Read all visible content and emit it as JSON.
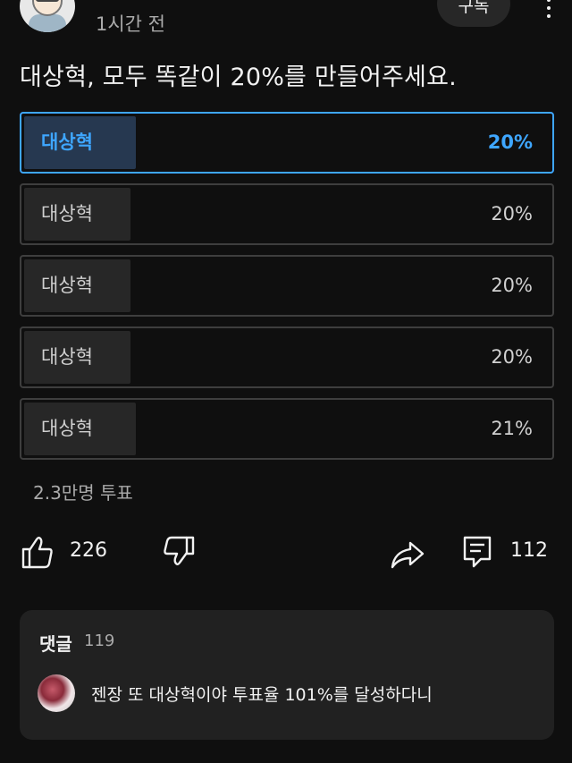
{
  "header": {
    "time_ago": "1시간 전",
    "subscribe_label": "구독"
  },
  "poll": {
    "question": "대상혁, 모두 똑같이 20%를 만들어주세요.",
    "options": [
      {
        "label": "대상혁",
        "percent_text": "20%",
        "fill_fraction": 0.21,
        "selected": true
      },
      {
        "label": "대상혁",
        "percent_text": "20%",
        "fill_fraction": 0.2,
        "selected": false
      },
      {
        "label": "대상혁",
        "percent_text": "20%",
        "fill_fraction": 0.2,
        "selected": false
      },
      {
        "label": "대상혁",
        "percent_text": "20%",
        "fill_fraction": 0.2,
        "selected": false
      },
      {
        "label": "대상혁",
        "percent_text": "21%",
        "fill_fraction": 0.21,
        "selected": false
      }
    ],
    "votes": "2.3만명 투표"
  },
  "actions": {
    "like_count": "226",
    "comment_count": "112"
  },
  "comments": {
    "title": "댓글",
    "count": "119",
    "top_comment": "젠장 또 대상혁이야 투표율 101%를 달성하다니"
  },
  "colors": {
    "accent": "#3ea6ff",
    "background": "#0f0f0f",
    "panel": "#212121"
  }
}
